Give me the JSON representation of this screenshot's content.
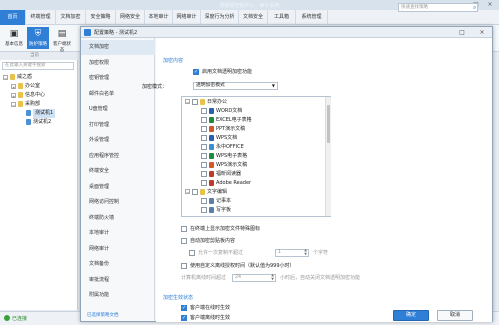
{
  "window": {
    "title": "网络版控制中心 - 审计系统"
  },
  "tabs": [
    "首页",
    "终端管理",
    "文档加密",
    "安全策略",
    "网络安全",
    "本地审计",
    "网络审计",
    "深度行为分析",
    "文档安全",
    "工具箱",
    "系统管理"
  ],
  "active_tab": 0,
  "search": {
    "placeholder": "快速查找策略"
  },
  "toolbar": [
    {
      "label": "基本信息",
      "icon": "info-icon"
    },
    {
      "label": "防护策略",
      "icon": "shield-icon"
    },
    {
      "label": "客户端状态",
      "icon": "client-icon"
    }
  ],
  "toolbar_active": 1,
  "nav_hint": "当前",
  "left": {
    "search_placeholder": "在此输入关键字搜索",
    "tree": [
      {
        "label": "威之盾",
        "level": 0,
        "toggle": "−"
      },
      {
        "label": "办公室",
        "level": 1,
        "toggle": "+"
      },
      {
        "label": "信息中心",
        "level": 1,
        "toggle": "+"
      },
      {
        "label": "采购部",
        "level": 1,
        "toggle": "−"
      },
      {
        "label": "测试机1",
        "level": 2,
        "toggle": "",
        "selected": true
      },
      {
        "label": "测试机2",
        "level": 2,
        "toggle": ""
      }
    ]
  },
  "status": {
    "text": "已连接"
  },
  "dialog": {
    "title": "配置策略 - 测试机2",
    "nav": [
      "文档加密",
      "加密权限",
      "密钥管理",
      "邮件白名单",
      "U盘管理",
      "打印管理",
      "外设管理",
      "应用程序管控",
      "终端安全",
      "桌面管理",
      "网络访问控制",
      "终端防火墙",
      "本地审计",
      "网络审计",
      "文档备份",
      "审批流程",
      "附属功能"
    ],
    "nav_active": 0,
    "nav_footer": "已选择策略文档",
    "section1": "加密内容",
    "enable_encryption": "启用文档透明加密功能",
    "mode_label": "加密模式：",
    "mode_value": "透明加密模式",
    "file_tree": [
      {
        "label": "日常办公",
        "level": 0,
        "toggle": "−",
        "color": "#e8c24a"
      },
      {
        "label": "WORD文档",
        "level": 1,
        "color": "#2b5fb5"
      },
      {
        "label": "EXCEL电子表格",
        "level": 1,
        "color": "#1f8b3f"
      },
      {
        "label": "PPT演示文稿",
        "level": 1,
        "color": "#d4572a"
      },
      {
        "label": "WPS文档",
        "level": 1,
        "color": "#2b5fb5"
      },
      {
        "label": "永中OFFICE",
        "level": 1,
        "color": "#3a8fd0"
      },
      {
        "label": "WPS电子表格",
        "level": 1,
        "color": "#1f8b3f"
      },
      {
        "label": "WPS演示文稿",
        "level": 1,
        "color": "#d4572a"
      },
      {
        "label": "福昕阅读器",
        "level": 1,
        "color": "#c0392b"
      },
      {
        "label": "Adobe Reader",
        "level": 1,
        "color": "#c0392b"
      },
      {
        "label": "文字编辑",
        "level": 0,
        "toggle": "−",
        "color": "#e8c24a"
      },
      {
        "label": "记事本",
        "level": 1,
        "color": "#5b7fa8"
      },
      {
        "label": "写字板",
        "level": 1,
        "color": "#5b7fa8"
      }
    ],
    "opt_show_icon": "在终端上显示加密文件特殊图标",
    "opt_auto_clip": "自动加密剪贴板内容",
    "opt_allow_copy": "允许一次复制不超过",
    "copy_value": "1",
    "copy_unit": "个字符",
    "opt_custom_auth": "使用自定义离线授权时间（默认值为999小时）",
    "auth_prefix": "计算机离线时间超过",
    "auth_value": "24",
    "auth_suffix": "小时后，自动关闭文档透明加密功能",
    "section2": "加密生效状态",
    "opt_online": "客户端在线时生效",
    "opt_offline": "客户端离线时生效",
    "btn_ok": "确定",
    "btn_cancel": "取消"
  }
}
